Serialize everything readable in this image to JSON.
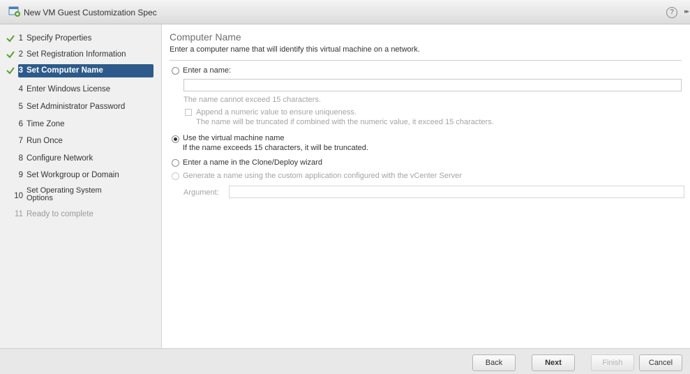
{
  "window": {
    "title": "New VM Guest Customization Spec",
    "help_label": "?",
    "expand_label": "▸▸"
  },
  "steps": [
    {
      "num": "1",
      "label": "Specify Properties",
      "state": "done"
    },
    {
      "num": "2",
      "label": "Set Registration Information",
      "state": "done"
    },
    {
      "num": "3",
      "label": "Set Computer Name",
      "state": "active"
    },
    {
      "num": "4",
      "label": "Enter Windows License",
      "state": "todo"
    },
    {
      "num": "5",
      "label": "Set Administrator Password",
      "state": "todo"
    },
    {
      "num": "6",
      "label": "Time Zone",
      "state": "todo"
    },
    {
      "num": "7",
      "label": "Run Once",
      "state": "todo"
    },
    {
      "num": "8",
      "label": "Configure Network",
      "state": "todo"
    },
    {
      "num": "9",
      "label": "Set Workgroup or Domain",
      "state": "todo"
    },
    {
      "num": "10",
      "label_line1": "Set Operating System",
      "label_line2": "Options",
      "state": "todo"
    },
    {
      "num": "11",
      "label": "Ready to complete",
      "state": "disabled"
    }
  ],
  "main": {
    "title": "Computer Name",
    "subtitle": "Enter a computer name that will identify this virtual machine on a network.",
    "opt_enter_name": "Enter a name:",
    "name_value": "",
    "name_hint": "The name cannot exceed 15 characters.",
    "append_label": "Append a numeric value to ensure uniqueness.",
    "append_hint": "The name will be truncated if combined with the numeric value, it exceed 15 characters.",
    "opt_use_vm_name": "Use the virtual machine name",
    "use_vm_hint": "If the name exceeds 15 characters, it will be truncated.",
    "opt_clone_wizard": "Enter a name in the Clone/Deploy wizard",
    "opt_custom_app": "Generate a name using the custom application configured with the vCenter Server",
    "argument_label": "Argument:",
    "argument_value": ""
  },
  "footer": {
    "back": "Back",
    "next": "Next",
    "finish": "Finish",
    "cancel": "Cancel"
  },
  "colors": {
    "active_step": "#2d5a8a",
    "check": "#5aa02c"
  }
}
